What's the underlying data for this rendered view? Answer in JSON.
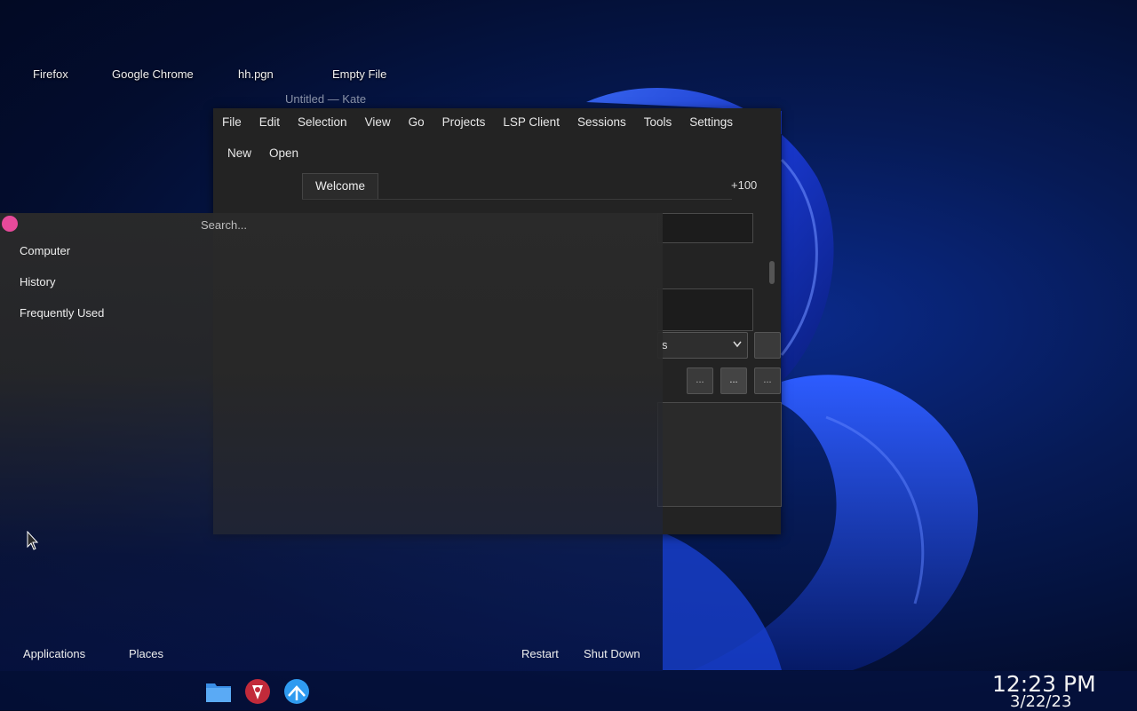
{
  "desktop": {
    "icons": [
      {
        "label": "Firefox"
      },
      {
        "label": "Google Chrome"
      },
      {
        "label": "hh.pgn"
      },
      {
        "label": "Empty File"
      }
    ]
  },
  "kate": {
    "title": "Untitled — Kate",
    "menu": [
      "File",
      "Edit",
      "Selection",
      "View",
      "Go",
      "Projects",
      "LSP Client",
      "Sessions",
      "Tools",
      "Settings"
    ],
    "toolbar": {
      "new_label": "New",
      "open_label": "Open"
    },
    "tab_label": "Welcome",
    "zoom_label": "+100",
    "combo_text": "s",
    "ellipsis": "..."
  },
  "launcher": {
    "search_placeholder": "Search...",
    "categories": [
      "Computer",
      "History",
      "Frequently Used"
    ],
    "applications_label": "Applications",
    "places_label": "Places",
    "restart_label": "Restart",
    "shutdown_label": "Shut Down"
  },
  "taskbar": {
    "icons": [
      "folder-icon",
      "kate-icon",
      "browser-icon"
    ],
    "time": "12:23 PM",
    "date": "3/22/23"
  },
  "colors": {
    "accent_avatar": "#e64a9a",
    "window_bg": "#232323",
    "wallpaper_blue": "#0a2a8a"
  }
}
